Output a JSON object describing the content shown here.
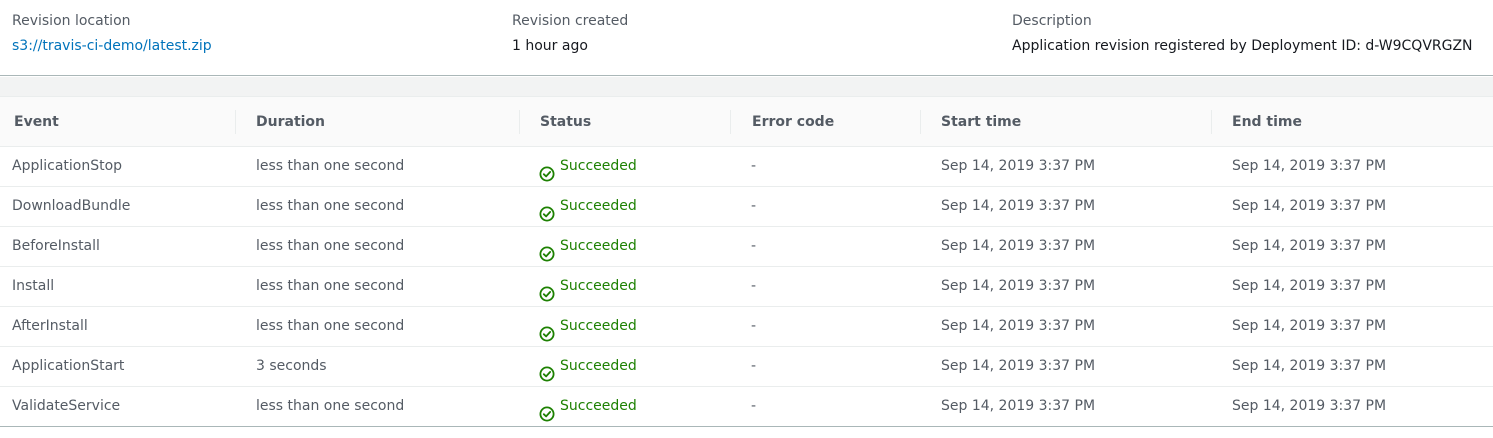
{
  "summary": {
    "revision_location_label": "Revision location",
    "revision_location_value": "s3://travis-ci-demo/latest.zip",
    "revision_created_label": "Revision created",
    "revision_created_value": "1 hour ago",
    "description_label": "Description",
    "description_value": "Application revision registered by Deployment ID: d-W9CQVRGZN"
  },
  "colors": {
    "link": "#0073bb",
    "success": "#1d8102",
    "muted": "#545b64"
  },
  "table": {
    "columns": [
      "Event",
      "Duration",
      "Status",
      "Error code",
      "Start time",
      "End time"
    ],
    "rows": [
      {
        "event": "ApplicationStop",
        "duration": "less than one second",
        "status": "Succeeded",
        "status_icon": "check-circle-icon",
        "error_code": "-",
        "start_time": "Sep 14, 2019 3:37 PM",
        "end_time": "Sep 14, 2019 3:37 PM"
      },
      {
        "event": "DownloadBundle",
        "duration": "less than one second",
        "status": "Succeeded",
        "status_icon": "check-circle-icon",
        "error_code": "-",
        "start_time": "Sep 14, 2019 3:37 PM",
        "end_time": "Sep 14, 2019 3:37 PM"
      },
      {
        "event": "BeforeInstall",
        "duration": "less than one second",
        "status": "Succeeded",
        "status_icon": "check-circle-icon",
        "error_code": "-",
        "start_time": "Sep 14, 2019 3:37 PM",
        "end_time": "Sep 14, 2019 3:37 PM"
      },
      {
        "event": "Install",
        "duration": "less than one second",
        "status": "Succeeded",
        "status_icon": "check-circle-icon",
        "error_code": "-",
        "start_time": "Sep 14, 2019 3:37 PM",
        "end_time": "Sep 14, 2019 3:37 PM"
      },
      {
        "event": "AfterInstall",
        "duration": "less than one second",
        "status": "Succeeded",
        "status_icon": "check-circle-icon",
        "error_code": "-",
        "start_time": "Sep 14, 2019 3:37 PM",
        "end_time": "Sep 14, 2019 3:37 PM"
      },
      {
        "event": "ApplicationStart",
        "duration": "3 seconds",
        "status": "Succeeded",
        "status_icon": "check-circle-icon",
        "error_code": "-",
        "start_time": "Sep 14, 2019 3:37 PM",
        "end_time": "Sep 14, 2019 3:37 PM"
      },
      {
        "event": "ValidateService",
        "duration": "less than one second",
        "status": "Succeeded",
        "status_icon": "check-circle-icon",
        "error_code": "-",
        "start_time": "Sep 14, 2019 3:37 PM",
        "end_time": "Sep 14, 2019 3:37 PM"
      }
    ]
  }
}
